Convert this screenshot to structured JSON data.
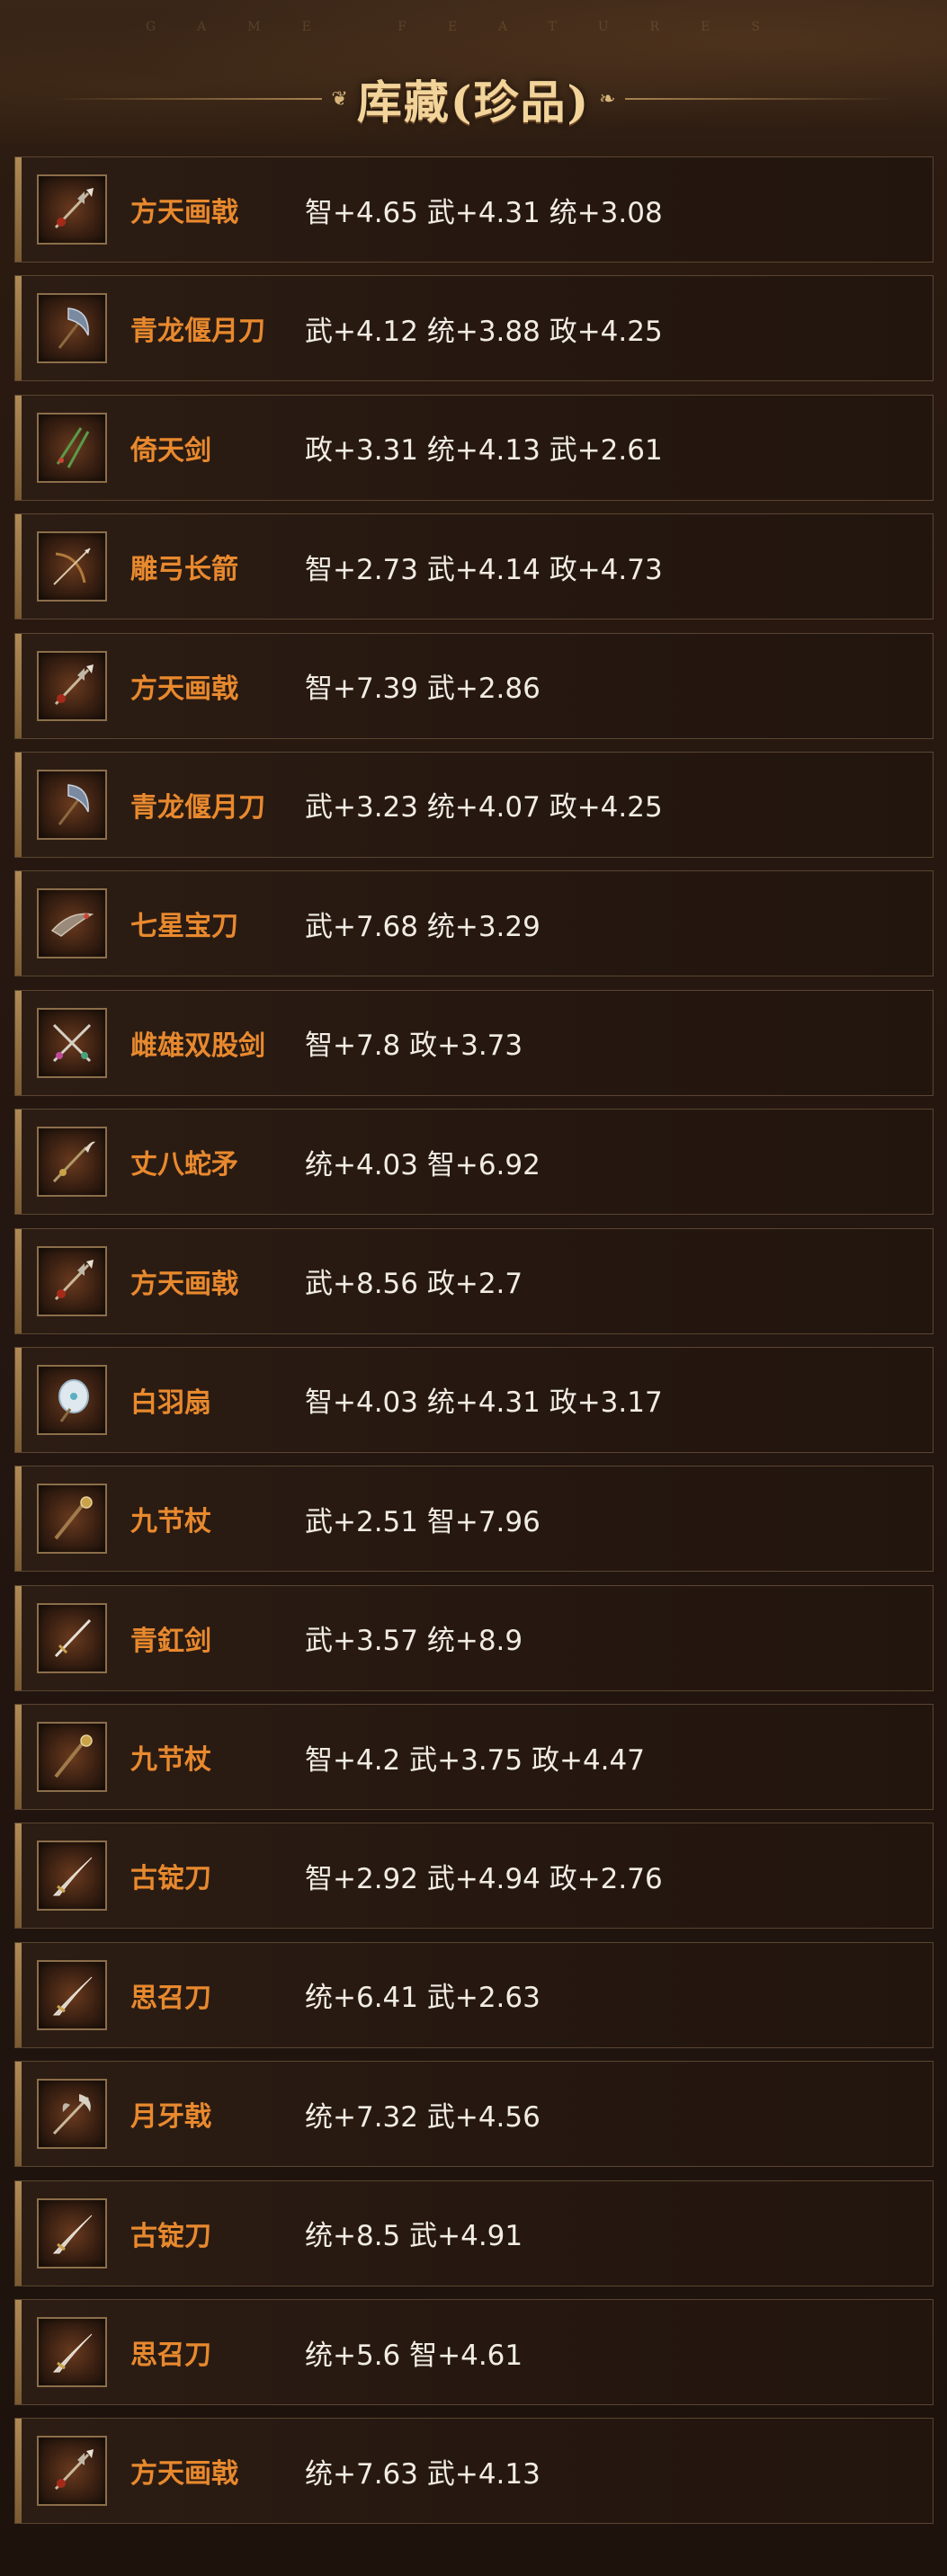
{
  "header": {
    "subtitle": "GAME FEATURES",
    "title": "库藏(珍品)"
  },
  "items": [
    {
      "name": "方天画戟",
      "stats": "智+4.65 武+4.31 统+3.08",
      "icon": "halberd-icon"
    },
    {
      "name": "青龙偃月刀",
      "stats": "武+4.12 统+3.88 政+4.25",
      "icon": "crescent-blade-icon"
    },
    {
      "name": "倚天剑",
      "stats": "政+3.31 统+4.13 武+2.61",
      "icon": "twin-sword-icon"
    },
    {
      "name": "雕弓长箭",
      "stats": "智+2.73 武+4.14 政+4.73",
      "icon": "bow-arrow-icon"
    },
    {
      "name": "方天画戟",
      "stats": "智+7.39 武+2.86",
      "icon": "halberd-icon"
    },
    {
      "name": "青龙偃月刀",
      "stats": "武+3.23 统+4.07 政+4.25",
      "icon": "crescent-blade-icon"
    },
    {
      "name": "七星宝刀",
      "stats": "武+7.68 统+3.29",
      "icon": "dragon-saber-icon"
    },
    {
      "name": "雌雄双股剑",
      "stats": "智+7.8 政+3.73",
      "icon": "crossed-swords-icon"
    },
    {
      "name": "丈八蛇矛",
      "stats": "统+4.03 智+6.92",
      "icon": "serpent-spear-icon"
    },
    {
      "name": "方天画戟",
      "stats": "武+8.56 政+2.7",
      "icon": "halberd-icon"
    },
    {
      "name": "白羽扇",
      "stats": "智+4.03 统+4.31 政+3.17",
      "icon": "feather-fan-icon"
    },
    {
      "name": "九节杖",
      "stats": "武+2.51 智+7.96",
      "icon": "staff-icon"
    },
    {
      "name": "青釭剑",
      "stats": "武+3.57 统+8.9",
      "icon": "sword-icon"
    },
    {
      "name": "九节杖",
      "stats": "智+4.2 武+3.75 政+4.47",
      "icon": "staff-icon"
    },
    {
      "name": "古锭刀",
      "stats": "智+2.92 武+4.94 政+2.76",
      "icon": "saber-icon"
    },
    {
      "name": "思召刀",
      "stats": "统+6.41 武+2.63",
      "icon": "saber-icon"
    },
    {
      "name": "月牙戟",
      "stats": "统+7.32 武+4.56",
      "icon": "crescent-halberd-icon"
    },
    {
      "name": "古锭刀",
      "stats": "统+8.5 武+4.91",
      "icon": "saber-icon"
    },
    {
      "name": "思召刀",
      "stats": "统+5.6 智+4.61",
      "icon": "saber-icon"
    },
    {
      "name": "方天画戟",
      "stats": "统+7.63 武+4.13",
      "icon": "halberd-icon"
    }
  ],
  "colors": {
    "title": "#f2d49a",
    "item_name": "#e8892e",
    "stats_text": "#f1ece4",
    "row_border": "#5a4530"
  }
}
